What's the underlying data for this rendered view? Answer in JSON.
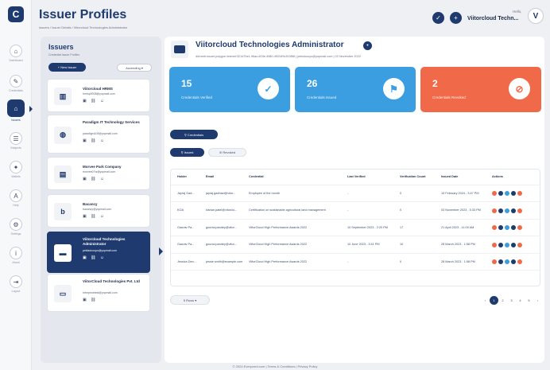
{
  "header": {
    "title": "Issuer Profiles",
    "breadcrumb": "Issuers / Issuer Details / Viitorcloud Technologies Administrator",
    "greeting": "Hello,",
    "user_name": "Viitorcloud Techn...",
    "avatar_letter": "V"
  },
  "rail": {
    "logo_letter": "C",
    "items": [
      {
        "label": "Dashboard",
        "icon": "dashboard-icon",
        "glyph": "⌂"
      },
      {
        "label": "Credentials",
        "icon": "credentials-icon",
        "glyph": "✎"
      },
      {
        "label": "Issuers",
        "icon": "issuers-icon",
        "glyph": "⌂"
      },
      {
        "label": "Subjects",
        "icon": "subjects-icon",
        "glyph": "☰"
      },
      {
        "label": "Wallets",
        "icon": "wallets-icon",
        "glyph": "✦"
      },
      {
        "label": "Help",
        "icon": "help-icon",
        "glyph": "A"
      },
      {
        "label": "Settings",
        "icon": "settings-icon",
        "glyph": "⚙"
      },
      {
        "label": "About",
        "icon": "about-icon",
        "glyph": "i"
      },
      {
        "label": "Logout",
        "icon": "logout-icon",
        "glyph": "⇥"
      }
    ]
  },
  "issuers": {
    "title": "Issuers",
    "subtitle": "Credential Issuer Profiles",
    "new_button": "+ New Issuer",
    "sort": "Ascending ▾",
    "cards": [
      {
        "name": "Viitorcloud HRMS",
        "email": "hrmsp0008@yopmail.com",
        "logo": "▥",
        "icons": "▣ ⛓ ☺"
      },
      {
        "name": "Paradigm IT Technology Services",
        "email": "paradigm105@yopmail.com",
        "logo": "◍",
        "icons": "▣ ⛓ ☺"
      },
      {
        "name": "Morvee Park Company",
        "email": "morvee07w@yopmail.com",
        "logo": "▤",
        "icons": "▣ ⛓ ☺"
      },
      {
        "name": "Bacancy",
        "email": "bacancy@yopmail.com",
        "logo": "b",
        "icons": "▣ ⛓ ☺"
      },
      {
        "name": "Viitorcloud Technologies Administrator",
        "email": "pekladcoopo@yopmail.com",
        "logo": "▬",
        "icons": "▣ ⛓ ☺"
      },
      {
        "name": "ViitorCloud Technologies Pvt. Ltd",
        "email": "hrtmpeoetest@yopmail.com",
        "logo": "▭",
        "icons": "▣ ⛓"
      }
    ]
  },
  "profile": {
    "name": "Viitorcloud Technologies Administrator",
    "meta": "did:web:issuer.polygon.testnet:321d7be1.96ac-603e-4980-4f024f9c303f88 | peklukuoyo@yopmail.com | 03 November 2022"
  },
  "stats": [
    {
      "value": "15",
      "label": "Credentials Verified",
      "color": "#3a9ee0",
      "icon": "✓",
      "icon_name": "verified-icon"
    },
    {
      "value": "26",
      "label": "Credentials Issued",
      "color": "#3a9ee0",
      "icon": "⚑",
      "icon_name": "issued-icon"
    },
    {
      "value": "2",
      "label": "Credentials Revoked",
      "color": "#f06a4a",
      "icon": "⊘",
      "icon_name": "revoked-icon"
    }
  ],
  "tabs": {
    "credentials": "⚲ Credentials",
    "issued": "⚲ Issued",
    "revoked": "⊘ Revoked"
  },
  "table": {
    "columns": [
      "Holder",
      "Email",
      "Credential",
      "Last Verified",
      "Verification Count",
      "Issued Date",
      "Actions"
    ],
    "rows": [
      [
        "Jayraj Gad...",
        "jayraj.gadhavi@vitor...",
        "Employee of the month",
        "-",
        "0",
        "19 February 2024 - 3:47 PM"
      ],
      [
        "KOA",
        "kishan.patel@vitorclo...",
        "Certification on sustainable agricultural land management",
        "-",
        "0",
        "03 November 2023 - 5:33 PM"
      ],
      [
        "Gaurav Pa...",
        "gourav.pandey@vitor...",
        "ViitorCloud High Performance Awards 2022",
        "10 September 2023 - 2:20 PM",
        "17",
        "21 April 2023 - 11:09 AM"
      ],
      [
        "Gaurav Pa...",
        "gourav.pandey@vitor...",
        "ViitorCloud High Performance Awards 2022",
        "10 June 2023 - 3:41 PM",
        "10",
        "28 March 2023 - 1:58 PM"
      ],
      [
        "Jessica Den...",
        "jessie smith@example.com",
        "ViitorCloud High Performance Awards 2022",
        "-",
        "0",
        "28 March 2023 - 1:58 PM"
      ]
    ]
  },
  "pagination": {
    "rows_select": "5 Rows ▾",
    "prev": "‹",
    "pages": [
      "1",
      "2",
      "3",
      "4",
      "5"
    ],
    "next": "›"
  },
  "footer": "© 2024 Everycred.com | Terms & Conditions | Privacy Policy",
  "colors": {
    "primary": "#1e3a6e",
    "blue": "#3a9ee0",
    "orange": "#f06a4a"
  }
}
